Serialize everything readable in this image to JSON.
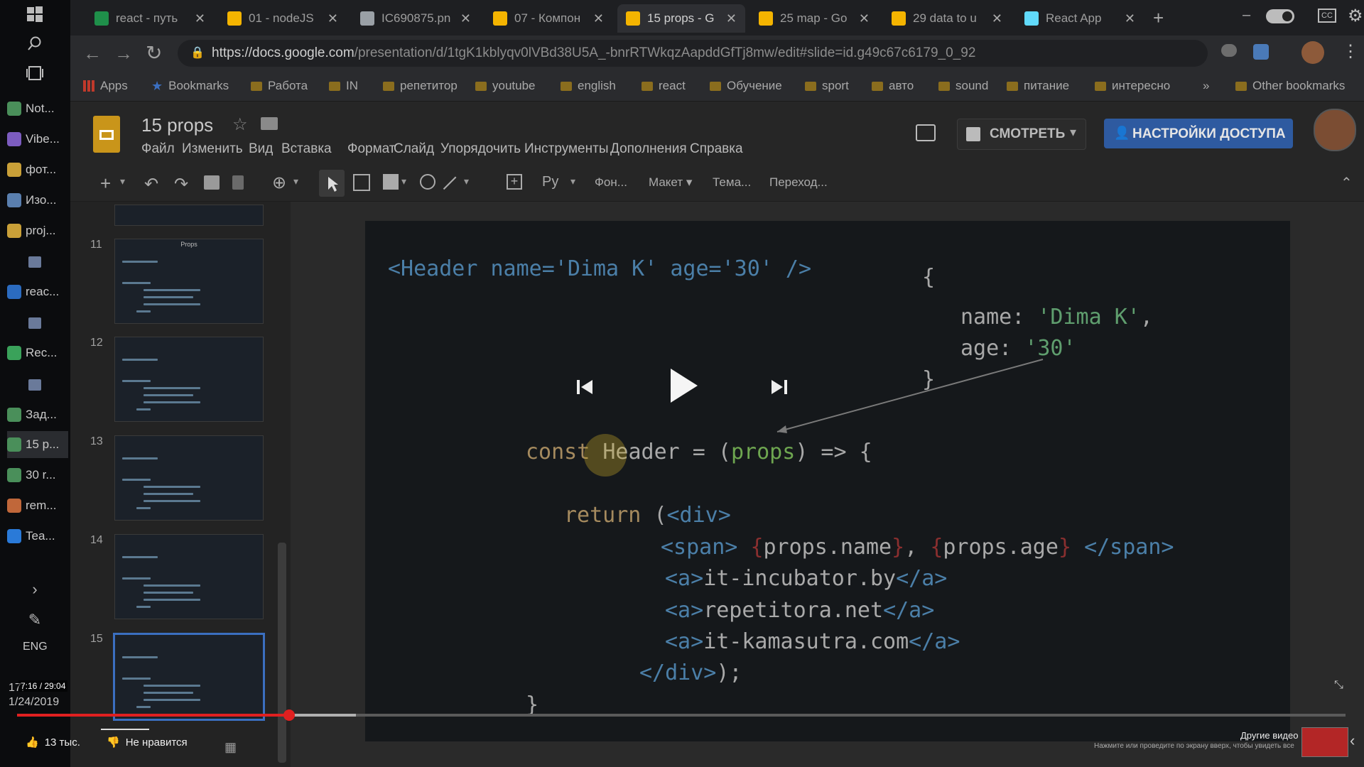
{
  "taskbar": {
    "items": [
      {
        "label": "Not...",
        "icon": "chrome-icon"
      },
      {
        "label": "Vibe...",
        "icon": "viber-icon"
      },
      {
        "label": "фот...",
        "icon": "folder-icon"
      },
      {
        "label": "Изо...",
        "icon": "image-icon"
      },
      {
        "label": "proj...",
        "icon": "folder-icon"
      },
      {
        "label": "reac...",
        "icon": "webstorm-icon"
      },
      {
        "label": "Rec...",
        "icon": "camtasia-icon"
      },
      {
        "label": "Зад...",
        "icon": "chrome-icon"
      },
      {
        "label": "15 p...",
        "icon": "chrome-icon"
      },
      {
        "label": "30 r...",
        "icon": "chrome-icon"
      },
      {
        "label": "rem...",
        "icon": "tool-icon"
      },
      {
        "label": "Tea...",
        "icon": "teamviewer-icon"
      }
    ],
    "lang": "ENG",
    "time_partial": "17:",
    "date": "1/24/2019"
  },
  "tabs": [
    {
      "title": "react - путь",
      "icon": "drive-icon",
      "color": "#1f8f4a"
    },
    {
      "title": "01 - nodeJS",
      "icon": "slides-icon",
      "color": "#f4b400"
    },
    {
      "title": "IC690875.pn",
      "icon": "file-icon",
      "color": "#9aa0a6"
    },
    {
      "title": "07 - Компон",
      "icon": "slides-icon",
      "color": "#f4b400"
    },
    {
      "title": "15 props - G",
      "icon": "slides-icon",
      "color": "#f4b400"
    },
    {
      "title": "25 map - Go",
      "icon": "slides-icon",
      "color": "#f4b400"
    },
    {
      "title": "29 data to u",
      "icon": "slides-icon",
      "color": "#f4b400"
    },
    {
      "title": "React App",
      "icon": "react-icon",
      "color": "#61dafb"
    }
  ],
  "address": {
    "url_domain": "https://docs.google.com",
    "url_path": "/presentation/d/1tgK1kblyqv0lVBd38U5A_-bnrRTWkqzAapddGfTj8mw/edit#slide=id.g49c67c6179_0_92"
  },
  "bookmarks": [
    "Apps",
    "Bookmarks",
    "Работа",
    "IN",
    "репетитор",
    "youtube",
    "english",
    "react",
    "Обучение",
    "sport",
    "авто",
    "sound",
    "питание",
    "интересно"
  ],
  "bookmarks_overflow": "»",
  "other_bookmarks": "Other bookmarks",
  "doc": {
    "title": "15 props",
    "menu": [
      "Файл",
      "Изменить",
      "Вид",
      "Вставка",
      "Формат",
      "Слайд",
      "Упорядочить",
      "Инструменты",
      "Дополнения",
      "Справка"
    ],
    "present_label": "СМОТРЕТЬ",
    "share_label": "НАСТРОЙКИ ДОСТУПА"
  },
  "toolbar": {
    "lang": "Ру",
    "background": "Фон...",
    "layout": "Макет",
    "theme": "Тема...",
    "transition": "Переход..."
  },
  "filmstrip": {
    "slides": [
      {
        "num": "11",
        "title": "Props"
      },
      {
        "num": "12"
      },
      {
        "num": "13"
      },
      {
        "num": "14"
      },
      {
        "num": "15"
      }
    ]
  },
  "slide": {
    "line1": "<Header name='Dima K' age='30' />",
    "obj_open": "{",
    "obj_name_key": "name: ",
    "obj_name_val": "'Dima K'",
    "obj_comma": ",",
    "obj_age_key": "age: ",
    "obj_age_val": "'30'",
    "obj_close": "}",
    "const_kw": "const ",
    "const_name": "Header",
    "const_eq": " = (",
    "const_param": "props",
    "const_arrow": ") => {",
    "return_kw": "return ",
    "return_paren": "(",
    "div_open": "<div>",
    "span_open": "<span>",
    "brace_l": "{",
    "props_name": "props.name",
    "brace_r": "}",
    "sep": ", ",
    "props_age": "props.age",
    "span_close": "</span>",
    "a_open": "<a>",
    "a_close": "</a>",
    "link1": "it-incubator.by",
    "link2": "repetitora.net",
    "link3": "it-kamasutra.com",
    "div_close": "</div>",
    "div_close_tail": ");",
    "fn_close": "}"
  },
  "video": {
    "time": "7:16 / 29:04",
    "likes": "13 тыс.",
    "dislike": "Не нравится",
    "other_videos": "Другие видео",
    "hint": "Нажмите или проведите по экрану вверх, чтобы увидеть все",
    "progress": 0.205,
    "buffered": 0.255
  }
}
